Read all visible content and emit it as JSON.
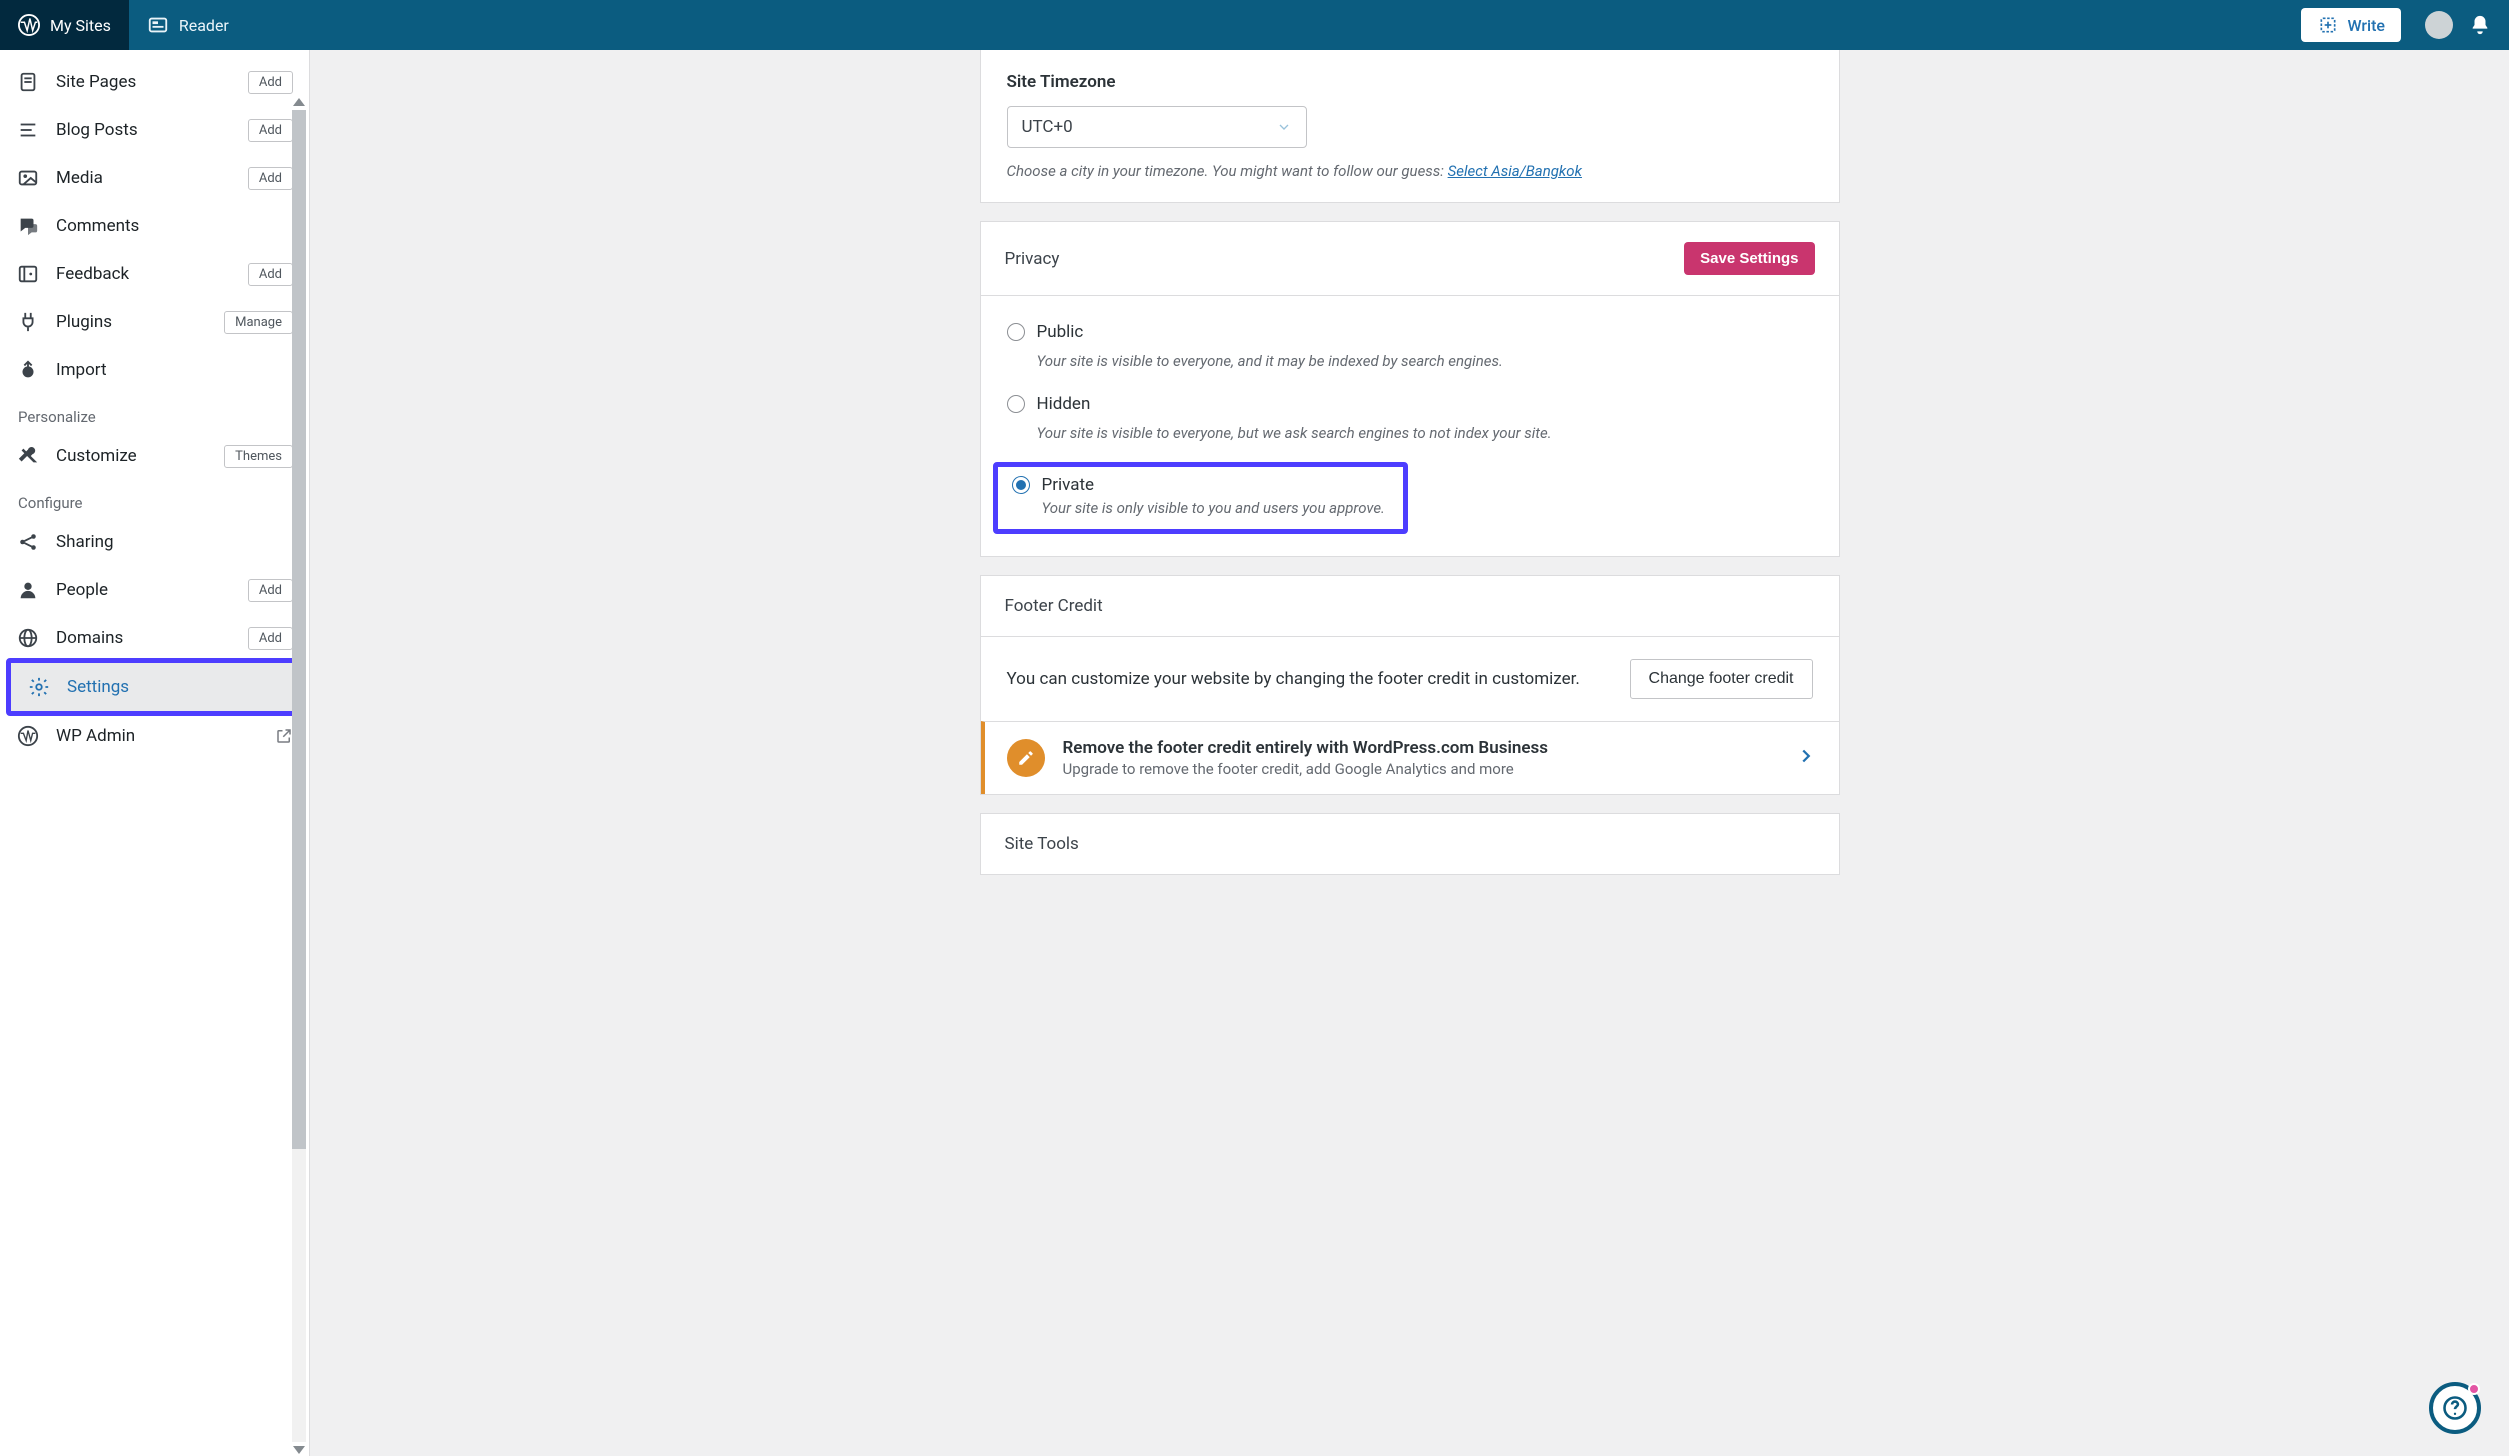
{
  "masterbar": {
    "my_sites": "My Sites",
    "reader": "Reader",
    "write": "Write"
  },
  "sidebar": {
    "items": [
      {
        "icon": "page",
        "label": "Site Pages",
        "badge": "Add"
      },
      {
        "icon": "posts",
        "label": "Blog Posts",
        "badge": "Add"
      },
      {
        "icon": "media",
        "label": "Media",
        "badge": "Add"
      },
      {
        "icon": "comments",
        "label": "Comments"
      },
      {
        "icon": "feedback",
        "label": "Feedback",
        "badge": "Add"
      },
      {
        "icon": "plugins",
        "label": "Plugins",
        "badge": "Manage"
      },
      {
        "icon": "import",
        "label": "Import"
      }
    ],
    "personalize_heading": "Personalize",
    "customize": {
      "label": "Customize",
      "badge": "Themes"
    },
    "configure_heading": "Configure",
    "configure": [
      {
        "icon": "share",
        "label": "Sharing"
      },
      {
        "icon": "people",
        "label": "People",
        "badge": "Add"
      },
      {
        "icon": "domains",
        "label": "Domains",
        "badge": "Add"
      },
      {
        "icon": "settings",
        "label": "Settings",
        "active": true
      },
      {
        "icon": "wp",
        "label": "WP Admin",
        "external": true
      }
    ]
  },
  "timezone": {
    "label": "Site Timezone",
    "value": "UTC+0",
    "hint_prefix": "Choose a city in your timezone. You might want to follow our guess: ",
    "hint_link": "Select Asia/Bangkok"
  },
  "privacy": {
    "title": "Privacy",
    "save": "Save Settings",
    "options": [
      {
        "label": "Public",
        "desc": "Your site is visible to everyone, and it may be indexed by search engines.",
        "checked": false
      },
      {
        "label": "Hidden",
        "desc": "Your site is visible to everyone, but we ask search engines to not index your site.",
        "checked": false
      },
      {
        "label": "Private",
        "desc": "Your site is only visible to you and users you approve.",
        "checked": true,
        "highlight": true
      }
    ]
  },
  "footer_credit": {
    "title": "Footer Credit",
    "desc": "You can customize your website by changing the footer credit in customizer.",
    "button": "Change footer credit",
    "upsell_title": "Remove the footer credit entirely with WordPress.com Business",
    "upsell_sub": "Upgrade to remove the footer credit, add Google Analytics and more"
  },
  "site_tools": {
    "title": "Site Tools"
  }
}
